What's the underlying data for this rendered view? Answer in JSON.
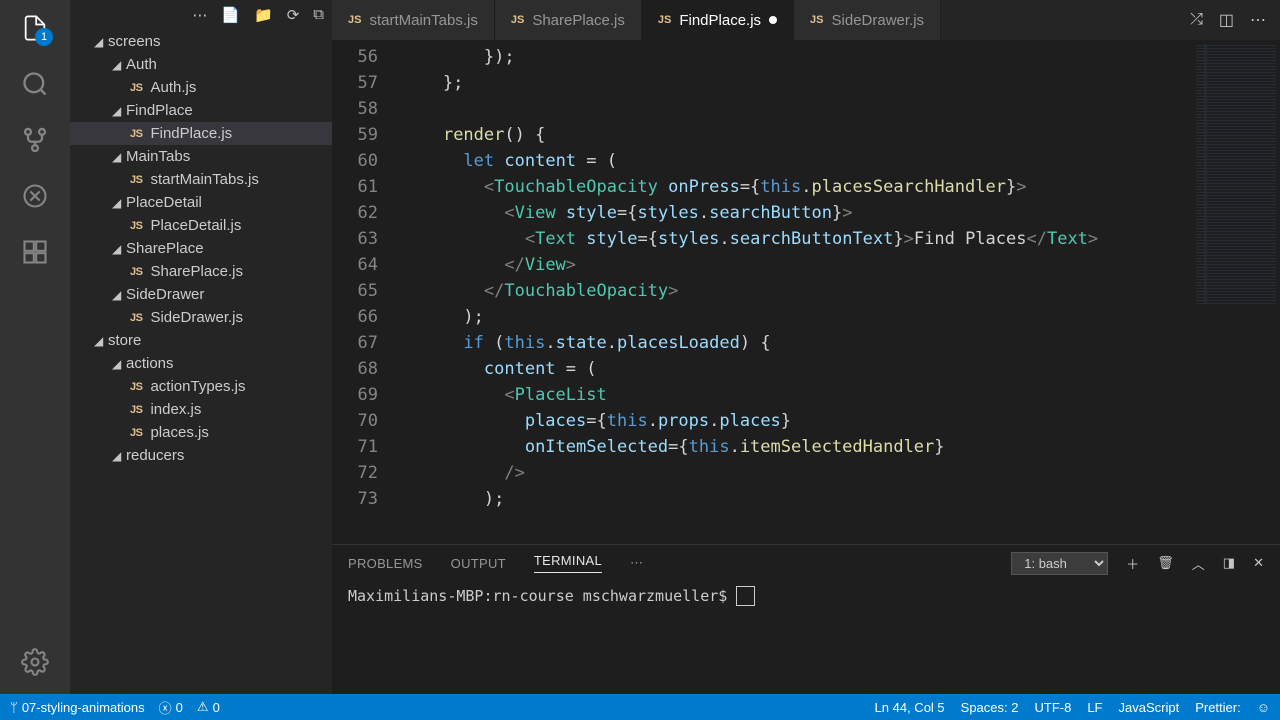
{
  "activityBadge": "1",
  "tabs": [
    {
      "label": "startMainTabs.js",
      "active": false
    },
    {
      "label": "SharePlace.js",
      "active": false
    },
    {
      "label": "FindPlace.js",
      "active": true,
      "dirty": true
    },
    {
      "label": "SideDrawer.js",
      "active": false
    }
  ],
  "tree": [
    {
      "label": "screens",
      "type": "folder",
      "indent": 1,
      "expanded": true
    },
    {
      "label": "Auth",
      "type": "folder",
      "indent": 2,
      "expanded": true
    },
    {
      "label": "Auth.js",
      "type": "js",
      "indent": 3
    },
    {
      "label": "FindPlace",
      "type": "folder",
      "indent": 2,
      "expanded": true
    },
    {
      "label": "FindPlace.js",
      "type": "js",
      "indent": 3,
      "selected": true
    },
    {
      "label": "MainTabs",
      "type": "folder",
      "indent": 2,
      "expanded": true
    },
    {
      "label": "startMainTabs.js",
      "type": "js",
      "indent": 3
    },
    {
      "label": "PlaceDetail",
      "type": "folder",
      "indent": 2,
      "expanded": true
    },
    {
      "label": "PlaceDetail.js",
      "type": "js",
      "indent": 3
    },
    {
      "label": "SharePlace",
      "type": "folder",
      "indent": 2,
      "expanded": true
    },
    {
      "label": "SharePlace.js",
      "type": "js",
      "indent": 3
    },
    {
      "label": "SideDrawer",
      "type": "folder",
      "indent": 2,
      "expanded": true
    },
    {
      "label": "SideDrawer.js",
      "type": "js",
      "indent": 3
    },
    {
      "label": "store",
      "type": "folder",
      "indent": 1,
      "expanded": true
    },
    {
      "label": "actions",
      "type": "folder",
      "indent": 2,
      "expanded": true
    },
    {
      "label": "actionTypes.js",
      "type": "js",
      "indent": 3
    },
    {
      "label": "index.js",
      "type": "js",
      "indent": 3
    },
    {
      "label": "places.js",
      "type": "js",
      "indent": 3
    },
    {
      "label": "reducers",
      "type": "folder",
      "indent": 2,
      "expanded": true
    }
  ],
  "lineStart": 56,
  "lineEnd": 73,
  "codeLines": [
    "        });",
    "    };",
    "",
    "    render() {",
    "      let content = (",
    "        <TouchableOpacity onPress={this.placesSearchHandler}>",
    "          <View style={styles.searchButton}>",
    "            <Text style={styles.searchButtonText}>Find Places</Text>",
    "          </View>",
    "        </TouchableOpacity>",
    "      );",
    "      if (this.state.placesLoaded) {",
    "        content = (",
    "          <PlaceList",
    "            places={this.props.places}",
    "            onItemSelected={this.itemSelectedHandler}",
    "          />",
    "        );"
  ],
  "panel": {
    "tabs": [
      "PROBLEMS",
      "OUTPUT",
      "TERMINAL"
    ],
    "activeTab": "TERMINAL",
    "selector": "1: bash",
    "terminalLine": "Maximilians-MBP:rn-course mschwarzmueller$ "
  },
  "status": {
    "branch": "07-styling-animations",
    "errors": "0",
    "warnings": "0",
    "position": "Ln 44, Col 5",
    "spaces": "Spaces: 2",
    "encoding": "UTF-8",
    "eol": "LF",
    "language": "JavaScript",
    "prettier": "Prettier:"
  }
}
